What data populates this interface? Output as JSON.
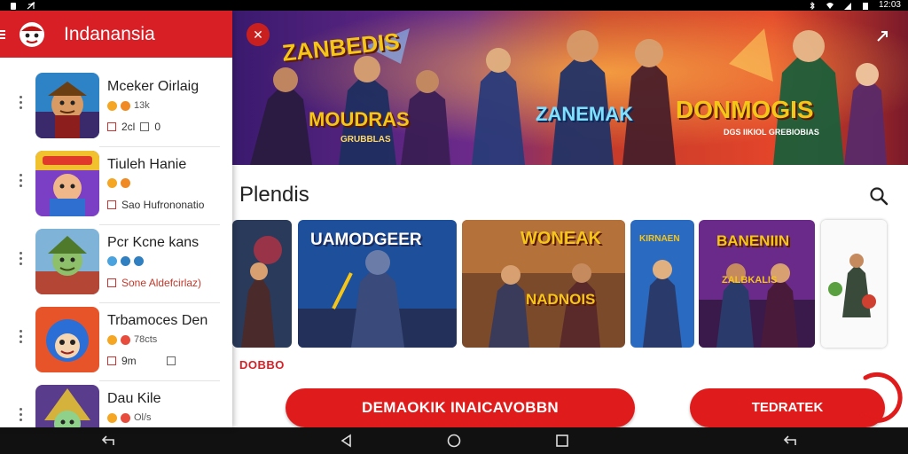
{
  "status_bar": {
    "time": "12:03",
    "icons": [
      "notification-icon",
      "mute-icon",
      "bluetooth-icon",
      "wifi-icon",
      "signal-icon",
      "battery-icon"
    ]
  },
  "sidebar": {
    "title": "Indanansia",
    "items": [
      {
        "title": "Mceker Oirlaig",
        "meta": "13k",
        "sub": "2cl",
        "sub2": "0",
        "thumb_icon": "pirate-hero-icon"
      },
      {
        "title": "Tiuleh Hanie",
        "meta": "",
        "sub": "Sao Hufrononatio",
        "sub2": "",
        "thumb_icon": "cartoon-knight-icon"
      },
      {
        "title": "Pcr Kcne kans",
        "meta": "",
        "sub": "Sone Aldefcirlaz)",
        "sub2": "",
        "thumb_icon": "goblin-hero-icon"
      },
      {
        "title": "Trbamoces Den",
        "meta": "78cts",
        "sub": "9m",
        "sub2": "",
        "thumb_icon": "round-character-icon"
      },
      {
        "title": "Dau Kile",
        "meta": "Ol/s",
        "sub": "",
        "sub2": "",
        "thumb_icon": "mage-hero-icon"
      }
    ]
  },
  "banner": {
    "title_left": "ZANBEDIS",
    "title_left_sub": "MOUDRAS",
    "title_left_tag": "GRUBBLAS",
    "title_center": "ZANEMAK",
    "title_right": "DONMOGIS",
    "title_right_sub": "DGS IIKIOL GREBIOBIAS"
  },
  "main": {
    "section_title": "Plendis",
    "red_tag": "DOBBO",
    "primary_button": "DEMAOKIK INAICAVOBBN",
    "secondary_button": "TEDRATEK",
    "cards": [
      {
        "label": "",
        "icon": "warrior-art-icon"
      },
      {
        "label": "UAMODGEER",
        "icon": "knight-art-icon"
      },
      {
        "label": "WONEAK",
        "sub": "NADNOIS",
        "icon": "duel-art-icon"
      },
      {
        "label": "KIRNAEN",
        "icon": "hero-art-icon"
      },
      {
        "label": "BANENIIN",
        "sub": "ZALBKALIS",
        "icon": "villain-art-icon"
      },
      {
        "label": "",
        "icon": "team-art-icon"
      }
    ]
  },
  "colors": {
    "brand_red": "#d91f26",
    "button_red": "#e01b1b"
  }
}
